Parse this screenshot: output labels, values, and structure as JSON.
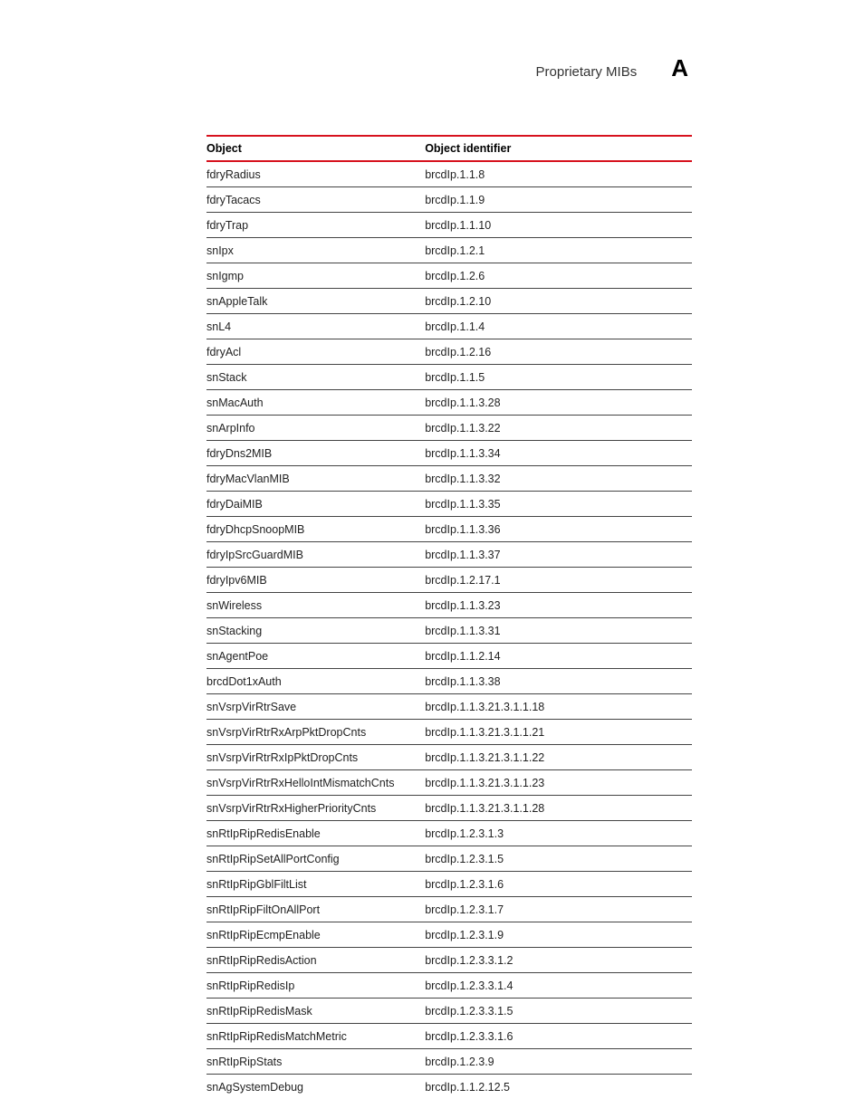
{
  "header": {
    "title": "Proprietary MIBs",
    "appendix_letter": "A"
  },
  "table": {
    "columns": {
      "object": "Object",
      "identifier": "Object identifier"
    },
    "rows": [
      {
        "object": "fdryRadius",
        "identifier": "brcdIp.1.1.8"
      },
      {
        "object": "fdryTacacs",
        "identifier": "brcdIp.1.1.9"
      },
      {
        "object": "fdryTrap",
        "identifier": "brcdIp.1.1.10"
      },
      {
        "object": "snIpx",
        "identifier": "brcdIp.1.2.1"
      },
      {
        "object": "snIgmp",
        "identifier": "brcdIp.1.2.6"
      },
      {
        "object": "snAppleTalk",
        "identifier": "brcdIp.1.2.10"
      },
      {
        "object": "snL4",
        "identifier": "brcdIp.1.1.4"
      },
      {
        "object": "fdryAcl",
        "identifier": "brcdIp.1.2.16"
      },
      {
        "object": "snStack",
        "identifier": "brcdIp.1.1.5"
      },
      {
        "object": "snMacAuth",
        "identifier": "brcdIp.1.1.3.28"
      },
      {
        "object": "snArpInfo",
        "identifier": "brcdIp.1.1.3.22"
      },
      {
        "object": "fdryDns2MIB",
        "identifier": "brcdIp.1.1.3.34"
      },
      {
        "object": "fdryMacVlanMIB",
        "identifier": "brcdIp.1.1.3.32"
      },
      {
        "object": "fdryDaiMIB",
        "identifier": "brcdIp.1.1.3.35"
      },
      {
        "object": "fdryDhcpSnoopMIB",
        "identifier": "brcdIp.1.1.3.36"
      },
      {
        "object": "fdryIpSrcGuardMIB",
        "identifier": "brcdIp.1.1.3.37"
      },
      {
        "object": "fdryIpv6MIB",
        "identifier": "brcdIp.1.2.17.1"
      },
      {
        "object": "snWireless",
        "identifier": "brcdIp.1.1.3.23"
      },
      {
        "object": "snStacking",
        "identifier": "brcdIp.1.1.3.31"
      },
      {
        "object": "snAgentPoe",
        "identifier": "brcdIp.1.1.2.14"
      },
      {
        "object": "brcdDot1xAuth",
        "identifier": "brcdIp.1.1.3.38"
      },
      {
        "object": "snVsrpVirRtrSave",
        "identifier": "brcdIp.1.1.3.21.3.1.1.18"
      },
      {
        "object": "snVsrpVirRtrRxArpPktDropCnts",
        "identifier": "brcdIp.1.1.3.21.3.1.1.21"
      },
      {
        "object": "snVsrpVirRtrRxIpPktDropCnts",
        "identifier": "brcdIp.1.1.3.21.3.1.1.22"
      },
      {
        "object": "snVsrpVirRtrRxHelloIntMismatchCnts",
        "identifier": "brcdIp.1.1.3.21.3.1.1.23"
      },
      {
        "object": "snVsrpVirRtrRxHigherPriorityCnts",
        "identifier": "brcdIp.1.1.3.21.3.1.1.28"
      },
      {
        "object": "snRtIpRipRedisEnable",
        "identifier": "brcdIp.1.2.3.1.3"
      },
      {
        "object": "snRtIpRipSetAllPortConfig",
        "identifier": "brcdIp.1.2.3.1.5"
      },
      {
        "object": "snRtIpRipGblFiltList",
        "identifier": "brcdIp.1.2.3.1.6"
      },
      {
        "object": "snRtIpRipFiltOnAllPort",
        "identifier": "brcdIp.1.2.3.1.7"
      },
      {
        "object": "snRtIpRipEcmpEnable",
        "identifier": "brcdIp.1.2.3.1.9"
      },
      {
        "object": "snRtIpRipRedisAction",
        "identifier": "brcdIp.1.2.3.3.1.2"
      },
      {
        "object": "snRtIpRipRedisIp",
        "identifier": "brcdIp.1.2.3.3.1.4"
      },
      {
        "object": "snRtIpRipRedisMask",
        "identifier": "brcdIp.1.2.3.3.1.5"
      },
      {
        "object": "snRtIpRipRedisMatchMetric",
        "identifier": "brcdIp.1.2.3.3.1.6"
      },
      {
        "object": "snRtIpRipStats",
        "identifier": "brcdIp.1.2.3.9"
      },
      {
        "object": "snAgSystemDebug",
        "identifier": "brcdIp.1.1.2.12.5"
      }
    ]
  }
}
